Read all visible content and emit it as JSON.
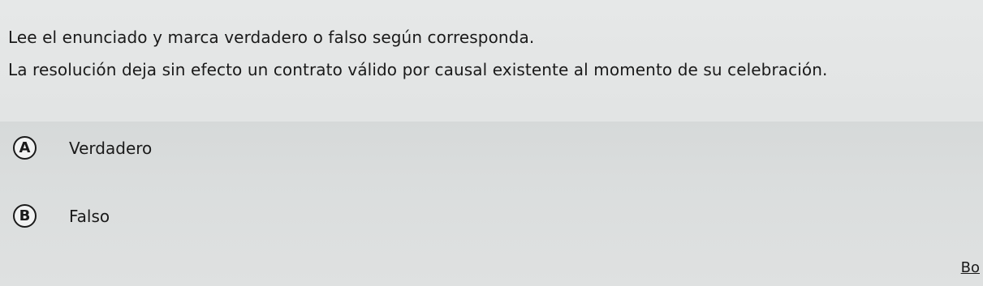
{
  "question": {
    "instruction": "Lee el enunciado y marca verdadero o falso según corresponda.",
    "statement": "La resolución deja sin efecto un contrato válido por causal existente al momento de su celebración."
  },
  "options": [
    {
      "letter": "A",
      "label": "Verdadero"
    },
    {
      "letter": "B",
      "label": "Falso"
    }
  ],
  "footer": {
    "link_text": "Bo"
  }
}
